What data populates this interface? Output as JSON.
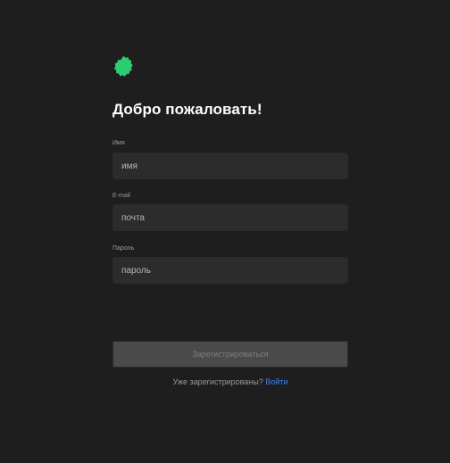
{
  "brand": {
    "logo_icon": "green-badge-icon",
    "logo_color": "#2ecc71"
  },
  "title": "Добро пожаловать!",
  "fields": [
    {
      "label": "Имя",
      "placeholder": "имя"
    },
    {
      "label": "E-mail",
      "placeholder": "почта"
    },
    {
      "label": "Пароль",
      "placeholder": "пароль"
    }
  ],
  "submit_label": "Зарегистрироваться",
  "footer": {
    "text": "Уже зарегистрированы?",
    "link_label": "Войти",
    "link_color": "#3b82f6"
  }
}
